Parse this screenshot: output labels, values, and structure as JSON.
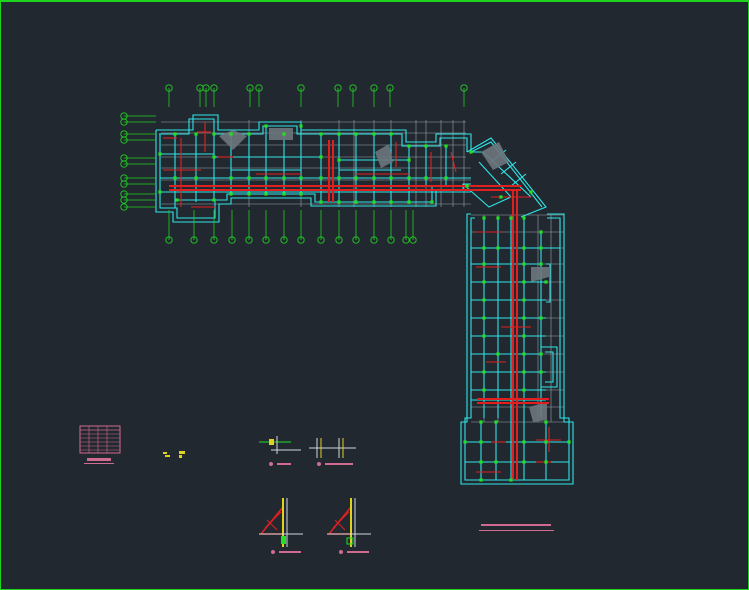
{
  "colors": {
    "background": "#212830",
    "frame": "#1fd41f",
    "wall": "#2ee6e6",
    "grid": "#9aa3ab",
    "beam": "#e02020",
    "marker": "#22e022",
    "detail_pink": "#d06a90",
    "detail_yellow": "#e0d020",
    "axis_bubble": "#22d022"
  },
  "icons": {
    "axis_marker": "circle-icon",
    "table_thumbnail": "table-icon"
  }
}
